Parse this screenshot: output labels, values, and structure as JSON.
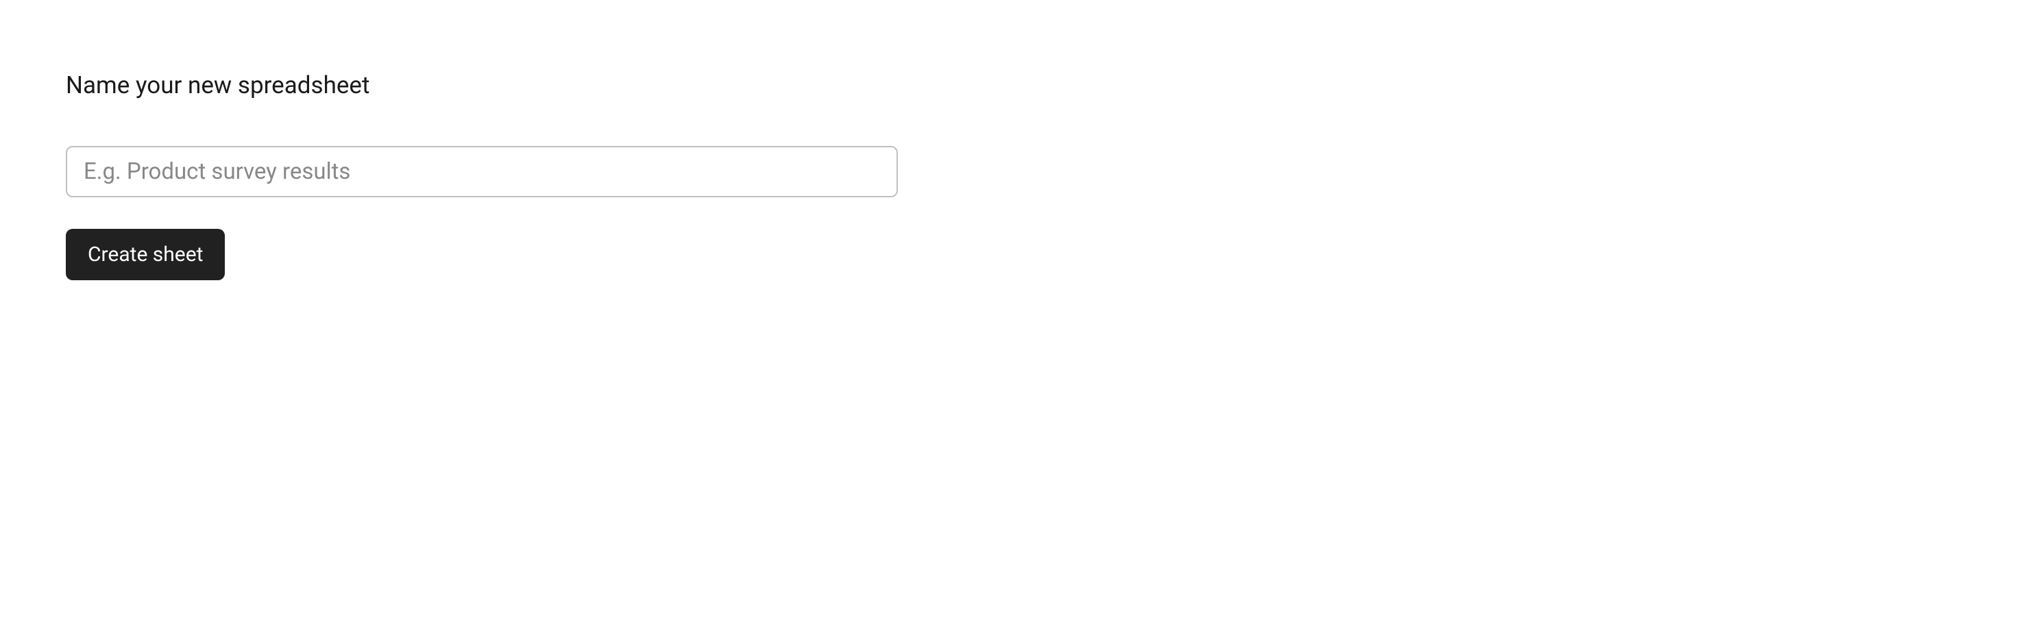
{
  "form": {
    "label": "Name your new spreadsheet",
    "input": {
      "value": "",
      "placeholder": "E.g. Product survey results"
    },
    "submit_label": "Create sheet"
  }
}
